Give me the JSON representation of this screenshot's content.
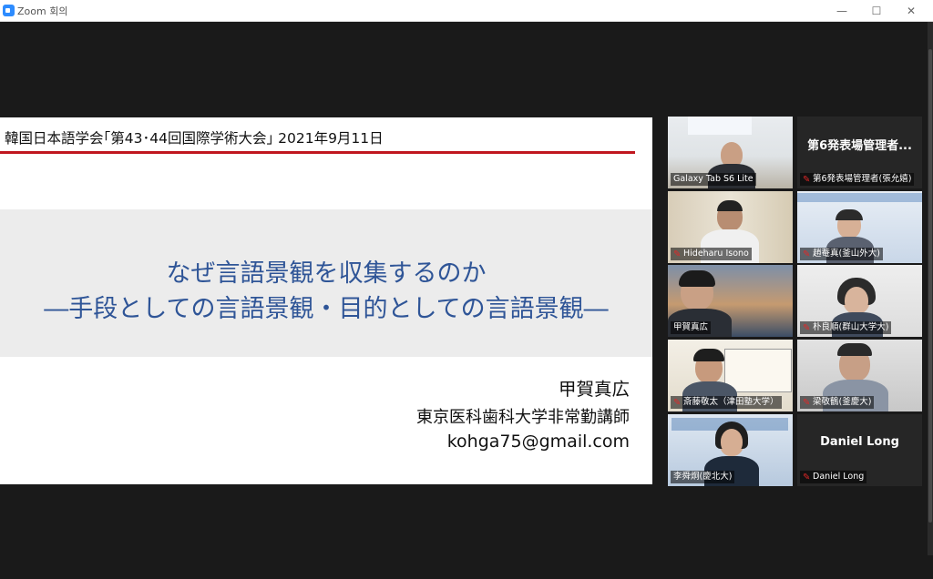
{
  "window": {
    "title": "Zoom 회의",
    "minimize_glyph": "—",
    "maximize_glyph": "☐",
    "close_glyph": "✕",
    "accent": "#2d8cff"
  },
  "slide": {
    "header": "韓国日本語学会｢第43･44回国際学術大会｣ 2021年9月11日",
    "title_line1": "なぜ言語景観を収集するのか",
    "title_line2": "―手段としての言語景観・目的としての言語景観―",
    "author": "甲賀真広",
    "affiliation": "東京医科歯科大学非常勤講師",
    "email": "kohga75@gmail.com",
    "title_color": "#2f5597",
    "rule_color": "#c0171f"
  },
  "participants": [
    {
      "name": "Galaxy Tab S6 Lite",
      "muted": false
    },
    {
      "name": "第6発表場管理者(張允嬉)",
      "display_text": "第6発表場管理者...",
      "muted": true
    },
    {
      "name": "Hideharu Isono",
      "muted": true
    },
    {
      "name": "趙菴真(釜山外大)",
      "muted": true
    },
    {
      "name": "甲賀真広",
      "muted": false,
      "active_speaker": true
    },
    {
      "name": "朴良順(群山大学大)",
      "muted": true
    },
    {
      "name": "斎藤敬太（津田塾大学）",
      "muted": true
    },
    {
      "name": "梁敬鶴(釜慶大)",
      "muted": true
    },
    {
      "name": "李舜炯(慶北大)",
      "muted": false
    },
    {
      "name": "Daniel Long",
      "display_text": "Daniel Long",
      "muted": true
    }
  ],
  "icons": {
    "muted_mic": "muted-mic-icon",
    "app": "zoom-app-icon"
  }
}
